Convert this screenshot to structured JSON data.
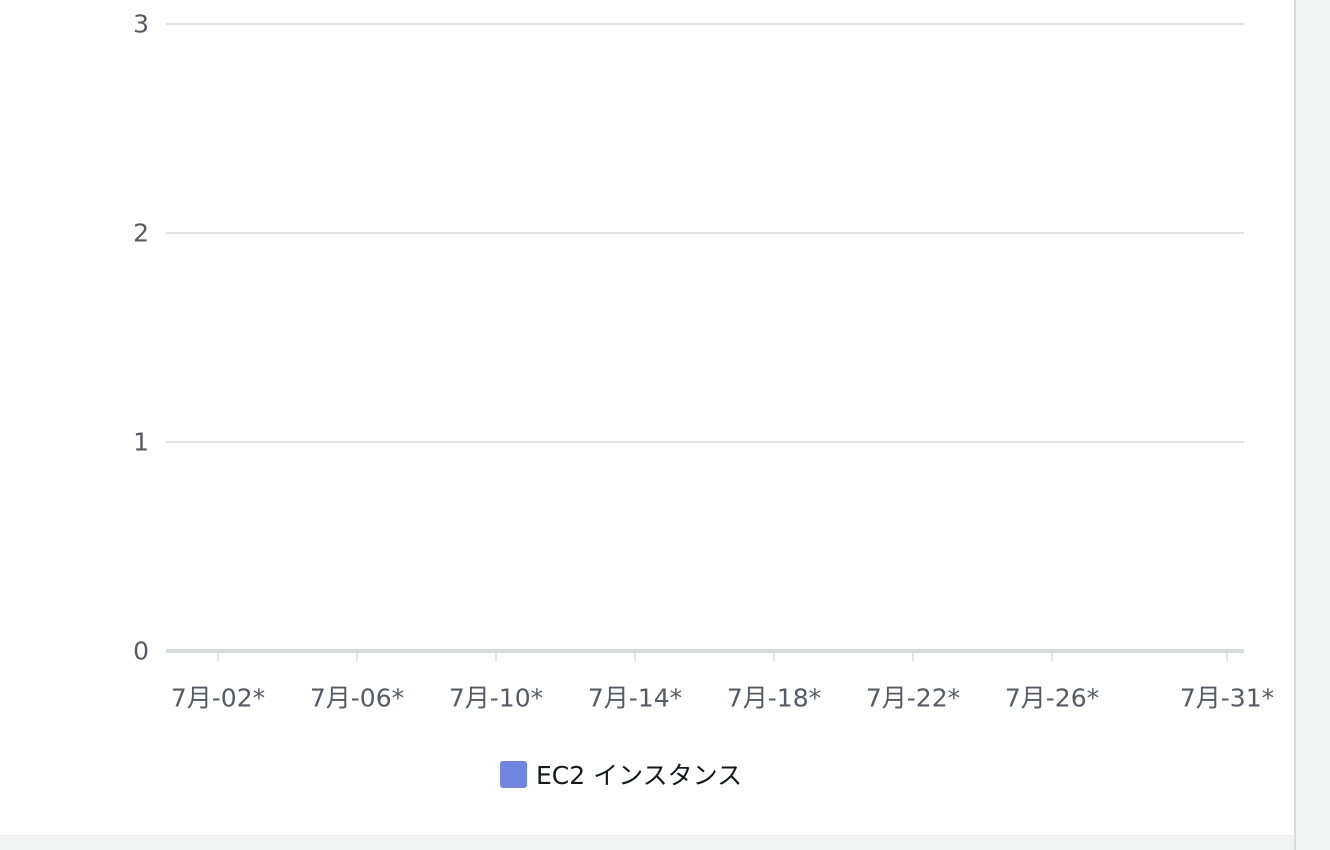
{
  "chart_data": {
    "type": "bar",
    "x_tick_labels": [
      "7月-02*",
      "7月-06*",
      "7月-10*",
      "7月-14*",
      "7月-18*",
      "7月-22*",
      "7月-26*",
      "7月-31*"
    ],
    "categories": [
      "7月-02*",
      "7月-06*",
      "7月-10*",
      "7月-14*",
      "7月-18*",
      "7月-22*",
      "7月-26*",
      "7月-31*"
    ],
    "series": [
      {
        "name": "EC2 インスタンス",
        "color": "#6f85e0",
        "values": [
          0,
          0,
          0,
          0,
          0,
          0,
          0,
          0
        ]
      }
    ],
    "y_ticks": [
      0,
      1,
      2,
      3
    ],
    "ylim": [
      0,
      3
    ],
    "grid": true,
    "legend_position": "bottom"
  },
  "legend": {
    "label": "EC2 インスタンス",
    "color": "#6f85e0"
  }
}
